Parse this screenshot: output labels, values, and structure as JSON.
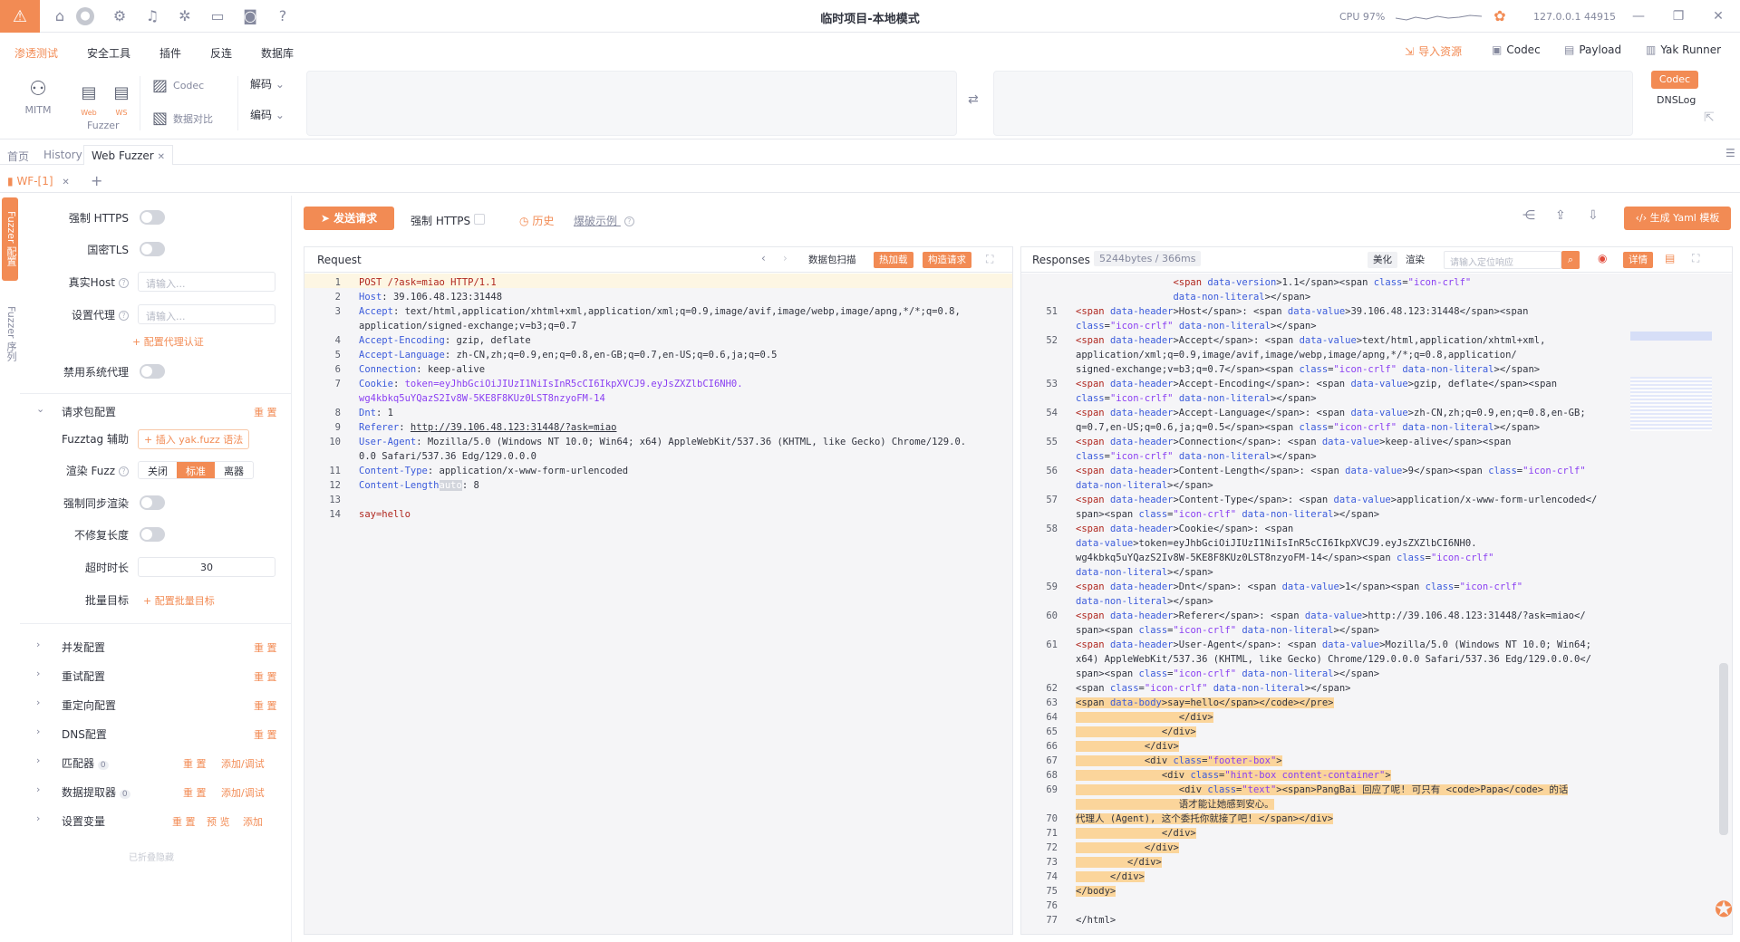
{
  "titlebar": {
    "title": "临时项目-本地模式",
    "cpu": "CPU 97%",
    "host": "127.0.0.1 44915"
  },
  "menu": {
    "items": [
      "渗透测试",
      "安全工具",
      "插件",
      "反连",
      "数据库"
    ],
    "right": [
      "导入资源",
      "Codec",
      "Payload",
      "Yak Runner"
    ]
  },
  "toolbar": {
    "mitm": "MITM",
    "fuzzer": "Fuzzer",
    "codec": "Codec",
    "compare": "数据对比",
    "decode": "解码",
    "encode": "编码",
    "codec_tab": "Codec",
    "dnslog": "DNSLog",
    "web": "Web",
    "ws": "WS"
  },
  "pagetabs": [
    "首页",
    "History",
    "Web Fuzzer"
  ],
  "subtab": "WF-[1]",
  "vtabs": [
    "Fuzzer 配置",
    "Fuzzer 序列"
  ],
  "left": {
    "force_https": "强制 HTTPS",
    "gm_tls": "国密TLS",
    "real_host": "真实Host",
    "real_host_ph": "请输入...",
    "proxy": "设置代理",
    "proxy_ph": "请输入...",
    "proxy_auth": "+ 配置代理认证",
    "disable_proxy": "禁用系统代理",
    "req_pkg": "请求包配置",
    "reset": "重 置",
    "fuzztag": "Fuzztag 辅助",
    "fuzztag_btn": "+ 插入 yak.fuzz 语法",
    "render": "渲染 Fuzz",
    "render_opts": [
      "关闭",
      "标准",
      "离器"
    ],
    "sync": "强制同步渲染",
    "nofix": "不修复长度",
    "timeout": "超时时长",
    "timeout_val": "30",
    "batch": "批量目标",
    "batch_link": "+ 配置批量目标",
    "groups": [
      "并发配置",
      "重试配置",
      "重定向配置",
      "DNS配置",
      "匹配器",
      "数据提取器",
      "设置变量"
    ],
    "matcher_count": "0",
    "extract_count": "0",
    "add_debug": "添加/调试",
    "preview": "预 览",
    "add": "添加",
    "collapsed": "已折叠隐藏"
  },
  "request": {
    "send": "发送请求",
    "force_https": "强制 HTTPS",
    "history": "历史",
    "example": "爆破示例",
    "title": "Request",
    "scan": "数据包扫描",
    "hot": "热加载",
    "build": "构造请求",
    "auto": "auto"
  },
  "response": {
    "title": "Responses",
    "size": "5244bytes / 366ms",
    "beautify": "美化",
    "render": "渲染",
    "search_ph": "请输入定位响应",
    "detail": "详情",
    "yaml": "生成 Yaml 模板"
  }
}
